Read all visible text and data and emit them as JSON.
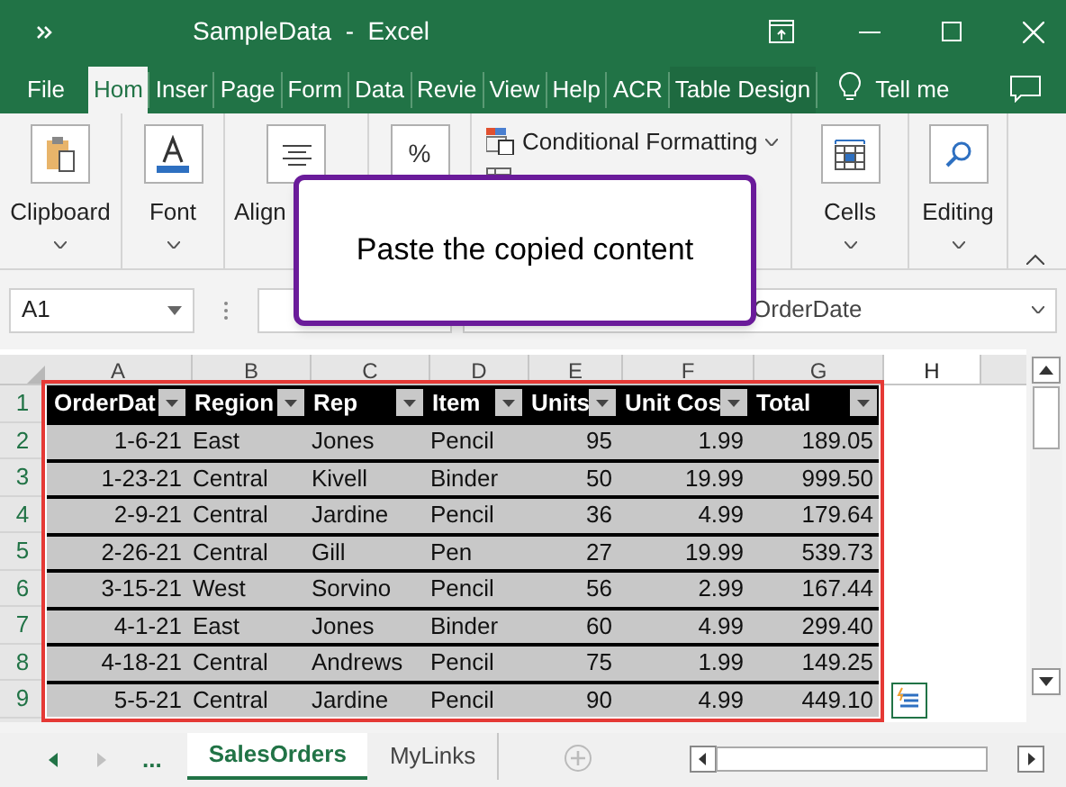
{
  "window": {
    "title": "SampleData  -  Excel"
  },
  "ribbon_tabs": [
    {
      "label": "File",
      "selected": false
    },
    {
      "label": "Hom",
      "selected": true
    },
    {
      "label": "Inser",
      "selected": false
    },
    {
      "label": "Page",
      "selected": false
    },
    {
      "label": "Form",
      "selected": false
    },
    {
      "label": "Data",
      "selected": false
    },
    {
      "label": "Revie",
      "selected": false
    },
    {
      "label": "View",
      "selected": false
    },
    {
      "label": "Help",
      "selected": false
    },
    {
      "label": "ACR",
      "selected": false
    },
    {
      "label": "Table Design",
      "selected": false
    }
  ],
  "tell_me": "Tell me",
  "ribbon": {
    "clipboard": "Clipboard",
    "font": "Font",
    "alignment": "Align",
    "number_symbol": "%",
    "conditional_formatting": "Conditional Formatting",
    "cells": "Cells",
    "editing": "Editing"
  },
  "callout": {
    "text": "Paste the copied content"
  },
  "formula_bar": {
    "name_box": "A1",
    "formula": "OrderDate"
  },
  "sheet": {
    "columns": [
      "A",
      "B",
      "C",
      "D",
      "E",
      "F",
      "G",
      "H"
    ],
    "row_numbers": [
      "1",
      "2",
      "3",
      "4",
      "5",
      "6",
      "7",
      "8",
      "9"
    ],
    "headers": [
      "OrderDat",
      "Region",
      "Rep",
      "Item",
      "Units",
      "Unit Cos",
      "Total"
    ],
    "rows": [
      [
        "1-6-21",
        "East",
        "Jones",
        "Pencil",
        "95",
        "1.99",
        "189.05"
      ],
      [
        "1-23-21",
        "Central",
        "Kivell",
        "Binder",
        "50",
        "19.99",
        "999.50"
      ],
      [
        "2-9-21",
        "Central",
        "Jardine",
        "Pencil",
        "36",
        "4.99",
        "179.64"
      ],
      [
        "2-26-21",
        "Central",
        "Gill",
        "Pen",
        "27",
        "19.99",
        "539.73"
      ],
      [
        "3-15-21",
        "West",
        "Sorvino",
        "Pencil",
        "56",
        "2.99",
        "167.44"
      ],
      [
        "4-1-21",
        "East",
        "Jones",
        "Binder",
        "60",
        "4.99",
        "299.40"
      ],
      [
        "4-18-21",
        "Central",
        "Andrews",
        "Pencil",
        "75",
        "1.99",
        "149.25"
      ],
      [
        "5-5-21",
        "Central",
        "Jardine",
        "Pencil",
        "90",
        "4.99",
        "449.10"
      ]
    ]
  },
  "sheet_tabs": {
    "more": "...",
    "tabs": [
      {
        "label": "SalesOrders",
        "selected": true
      },
      {
        "label": "MyLinks",
        "selected": false
      }
    ]
  }
}
